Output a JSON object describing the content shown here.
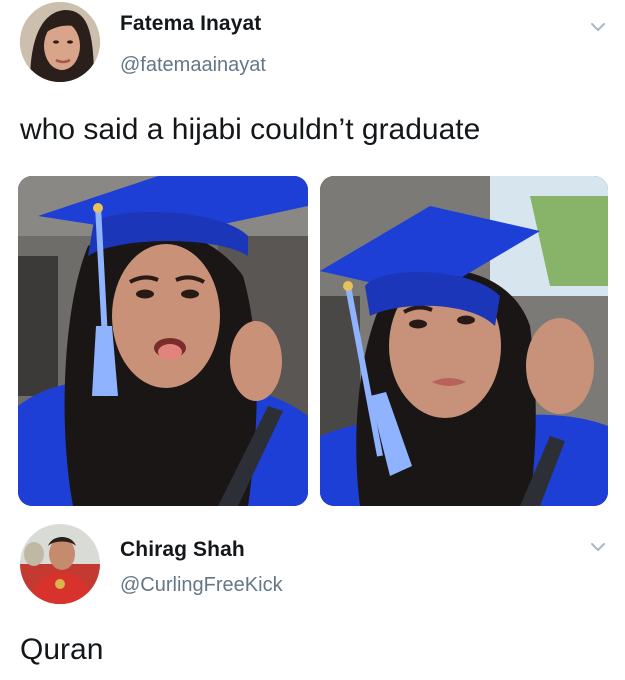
{
  "tweets": [
    {
      "author": {
        "name": "Fatema Inayat",
        "handle": "@fatemaainayat"
      },
      "text": "who said a hijabi couldn’t graduate",
      "menu_icon": "chevron-down-icon",
      "media": [
        {
          "kind": "photo",
          "subject": "graduate-selfie-tongue-out"
        },
        {
          "kind": "photo",
          "subject": "graduate-selfie-looking-up"
        }
      ]
    },
    {
      "author": {
        "name": "Chirag Shah",
        "handle": "@CurlingFreeKick"
      },
      "text": "Quran",
      "menu_icon": "chevron-down-icon"
    }
  ],
  "colors": {
    "text": "#14171a",
    "secondary_text": "#657786",
    "gown_blue": "#1e3fd6",
    "tassel_blue": "#8fb3ff"
  }
}
